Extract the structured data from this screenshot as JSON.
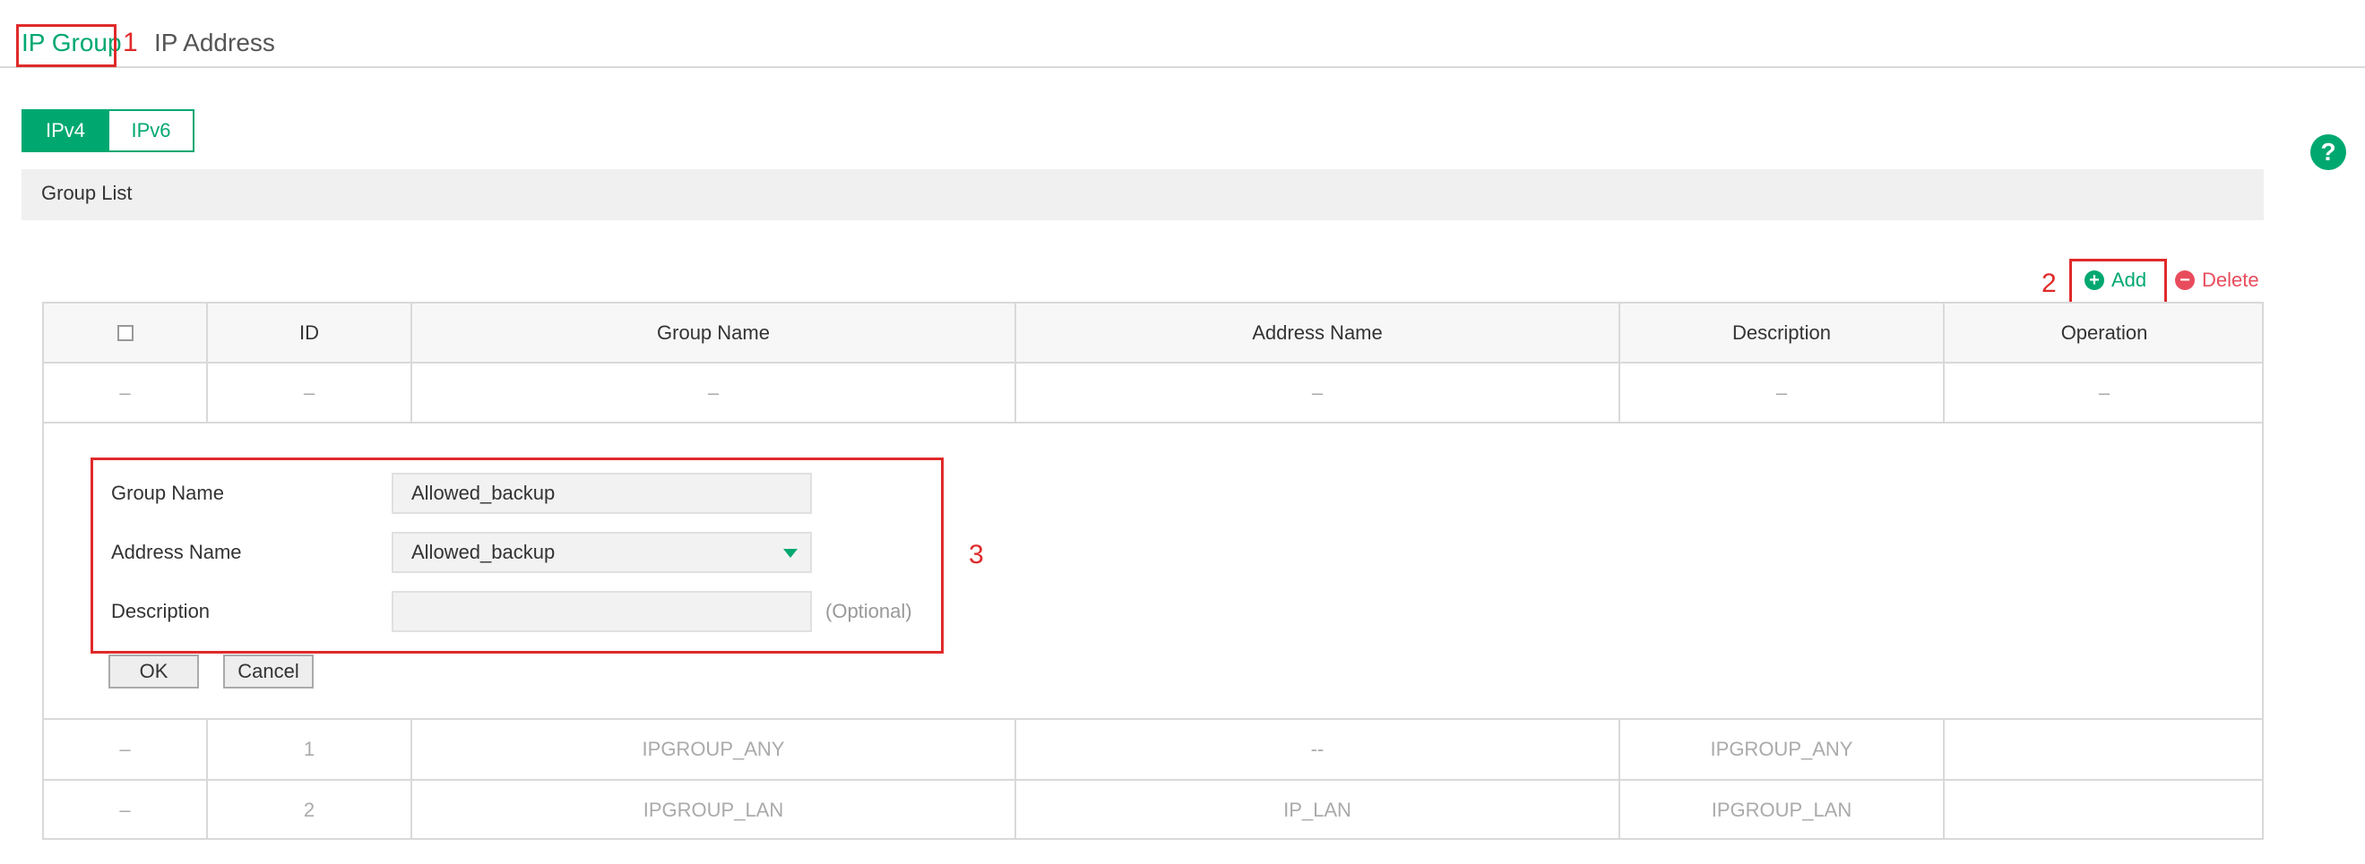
{
  "tabs": {
    "active": "IP Group",
    "inactive": "IP Address"
  },
  "toggle": {
    "ipv4": "IPv4",
    "ipv6": "IPv6"
  },
  "help": {
    "symbol": "?"
  },
  "group_list": {
    "title": "Group List"
  },
  "actions": {
    "add": "Add",
    "delete": "Delete",
    "add_symbol": "+",
    "delete_symbol": "−"
  },
  "annotations": {
    "n1": "1",
    "n2": "2",
    "n3": "3"
  },
  "table": {
    "headers": [
      "ID",
      "Group Name",
      "Address Name",
      "Description",
      "Operation"
    ],
    "placeholder_row": [
      "–",
      "–",
      "–",
      "–",
      "–",
      "–"
    ],
    "rows": [
      [
        "–",
        "1",
        "IPGROUP_ANY",
        "--",
        "IPGROUP_ANY",
        ""
      ],
      [
        "–",
        "2",
        "IPGROUP_LAN",
        "IP_LAN",
        "IPGROUP_LAN",
        ""
      ]
    ]
  },
  "form": {
    "group_name_label": "Group Name",
    "group_name_value": "Allowed_backup",
    "address_name_label": "Address Name",
    "address_name_value": "Allowed_backup",
    "description_label": "Description",
    "description_value": "",
    "optional_hint": "(Optional)",
    "ok": "OK",
    "cancel": "Cancel"
  },
  "colors": {
    "accent": "#00a870",
    "danger": "#e84c5c",
    "annotation": "#e02a2a"
  }
}
